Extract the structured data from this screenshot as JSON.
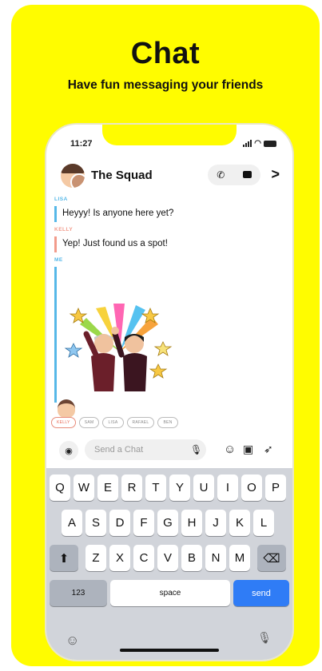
{
  "promo": {
    "headline": "Chat",
    "subhead": "Have fun messaging your friends"
  },
  "status_bar": {
    "time": "11:27"
  },
  "chat": {
    "group_name": "The Squad",
    "messages": [
      {
        "sender": "LISA",
        "text": "Heyyy! Is anyone here yet?",
        "color": "#56B8E8"
      },
      {
        "sender": "KELLY",
        "text": "Yep! Just found us a spot!",
        "color": "#F29B8B"
      },
      {
        "sender": "ME",
        "color": "#56B8E8"
      }
    ],
    "present_friends": [
      "KELLY",
      "SAM",
      "LISA",
      "RAFAEL",
      "BEN"
    ]
  },
  "composer": {
    "placeholder": "Send a Chat"
  },
  "keyboard": {
    "row1": [
      "Q",
      "W",
      "E",
      "R",
      "T",
      "Y",
      "U",
      "I",
      "O",
      "P"
    ],
    "row2": [
      "A",
      "S",
      "D",
      "F",
      "G",
      "H",
      "J",
      "K",
      "L"
    ],
    "row3": [
      "Z",
      "X",
      "C",
      "V",
      "B",
      "N",
      "M"
    ],
    "numbers_label": "123",
    "space_label": "space",
    "send_label": "send"
  },
  "colors": {
    "brand_yellow": "#FFFC00",
    "send_blue": "#2F7CF6"
  }
}
